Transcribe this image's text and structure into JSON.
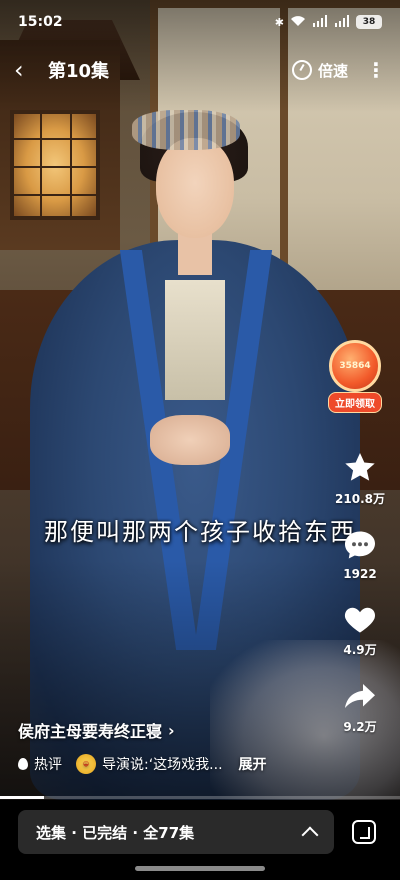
{
  "status_bar": {
    "time": "15:02",
    "battery": "38"
  },
  "nav": {
    "episode_title": "第10集",
    "speed_label": "倍速"
  },
  "coin_widget": {
    "count": "35864",
    "button_label": "立即领取"
  },
  "subtitle": "那便叫那两个孩子收拾东西",
  "actions": {
    "favorite_count": "210.8万",
    "comment_count": "1922",
    "like_count": "4.9万",
    "share_count": "9.2万"
  },
  "info": {
    "series_title": "侯府主母要寿终正寝",
    "hot_label": "热评",
    "hot_comment": "导演说:‘这场戏我...",
    "expand_label": "展开",
    "progress": 0.11
  },
  "episodes_bar": {
    "label": "选集 · 已完结 · 全77集"
  }
}
